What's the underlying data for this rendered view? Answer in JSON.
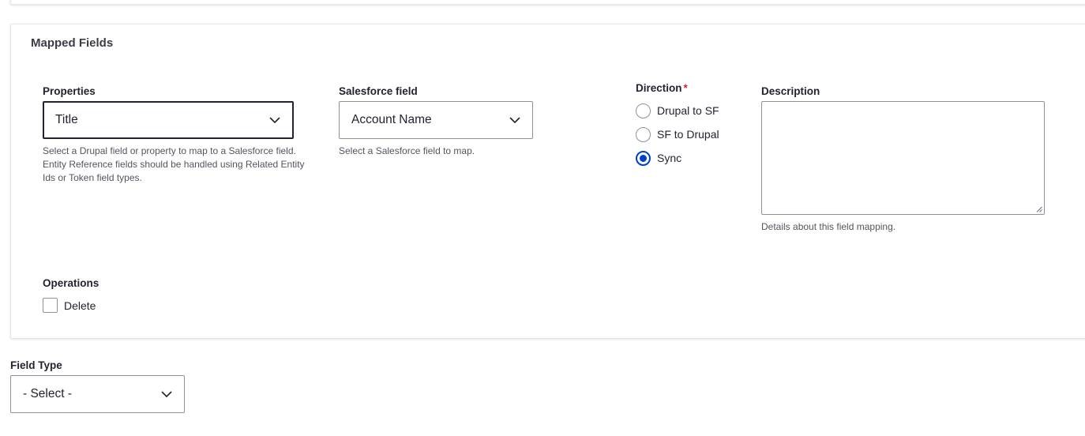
{
  "mapped_fields": {
    "title": "Mapped Fields",
    "properties": {
      "label": "Properties",
      "value": "Title",
      "help": "Select a Drupal field or property to map to a Salesforce field. Entity Reference fields should be handled using Related Entity Ids or Token field types."
    },
    "salesforce_field": {
      "label": "Salesforce field",
      "value": "Account Name",
      "help": "Select a Salesforce field to map."
    },
    "direction": {
      "label": "Direction",
      "required_marker": "*",
      "options": [
        "Drupal to SF",
        "SF to Drupal",
        "Sync"
      ],
      "selected": "Sync"
    },
    "description": {
      "label": "Description",
      "value": "",
      "help": "Details about this field mapping."
    },
    "operations": {
      "label": "Operations",
      "delete_label": "Delete",
      "delete_checked": false
    }
  },
  "field_type": {
    "label": "Field Type",
    "value": "- Select -"
  },
  "colors": {
    "accent": "#003ecc",
    "required": "#d72222",
    "border": "#8e929c",
    "text": "#222330",
    "help_text": "#545560"
  },
  "icons": {
    "select_arrow": "chevron-down-icon",
    "textarea_resize": "resize-grip-icon"
  }
}
